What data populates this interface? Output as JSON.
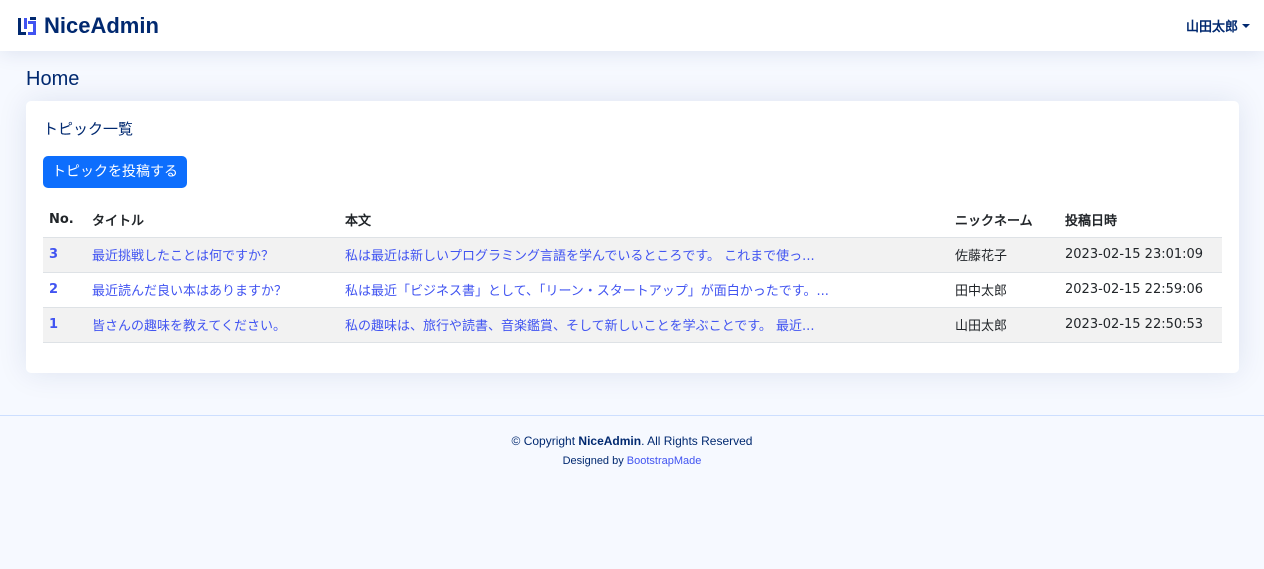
{
  "header": {
    "logo_text": "NiceAdmin",
    "profile_name": "山田太郎"
  },
  "page": {
    "title": "Home"
  },
  "card": {
    "title": "トピック一覧",
    "post_button": "トピックを投稿する"
  },
  "table": {
    "headers": [
      "No.",
      "タイトル",
      "本文",
      "ニックネーム",
      "投稿日時"
    ],
    "rows": [
      {
        "no": "3",
        "title": "最近挑戦したことは何ですか？",
        "body": "私は最近は新しいプログラミング言語を学んでいるところです。 これまで使っ...",
        "nickname": "佐藤花子",
        "posted_at": "2023-02-15 23:01:09"
      },
      {
        "no": "2",
        "title": "最近読んだ良い本はありますか？",
        "body": "私は最近「ビジネス書」として、「リーン・スタートアップ」が面白かったです。...",
        "nickname": "田中太郎",
        "posted_at": "2023-02-15 22:59:06"
      },
      {
        "no": "1",
        "title": "皆さんの趣味を教えてください。",
        "body": "私の趣味は、旅行や読書、音楽鑑賞、そして新しいことを学ぶことです。 最近...",
        "nickname": "山田太郎",
        "posted_at": "2023-02-15 22:50:53"
      }
    ]
  },
  "footer": {
    "copyright_prefix": "© Copyright",
    "brand": "NiceAdmin",
    "copyright_suffix": ". All Rights Reserved",
    "designed_by": "Designed by",
    "designer": "BootstrapMade"
  },
  "colors": {
    "brand": "#012970",
    "accent": "#4154f1",
    "button": "#0d6efd",
    "background": "#f6f9ff"
  }
}
